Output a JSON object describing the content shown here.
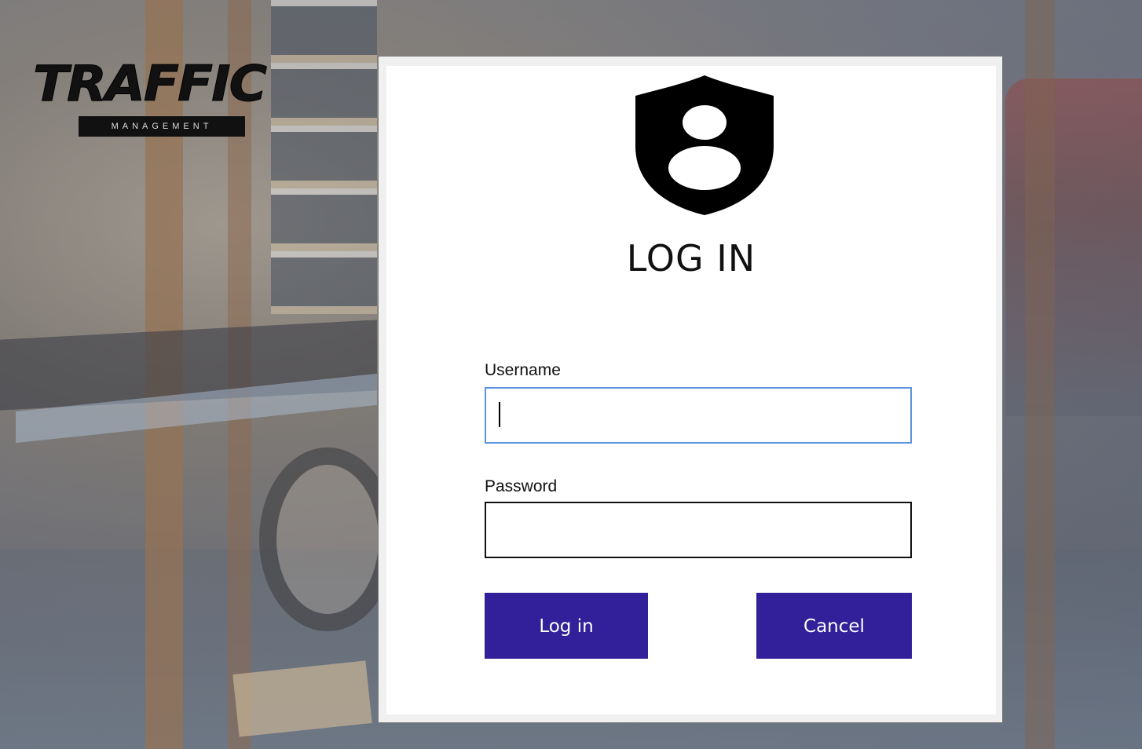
{
  "logo": {
    "wordmark": "TRAFFIC",
    "subtitle": "MANAGEMENT"
  },
  "dialog": {
    "title": "LOG IN",
    "icon": "user-shield-icon",
    "username": {
      "label": "Username",
      "value": "",
      "placeholder": ""
    },
    "password": {
      "label": "Password",
      "value": "",
      "placeholder": ""
    },
    "buttons": {
      "login_label": "Log in",
      "cancel_label": "Cancel"
    }
  },
  "colors": {
    "button_bg": "#32209a",
    "button_text": "#ffffff",
    "focus_border": "#5b93e0",
    "dialog_bg": "#ffffff"
  }
}
